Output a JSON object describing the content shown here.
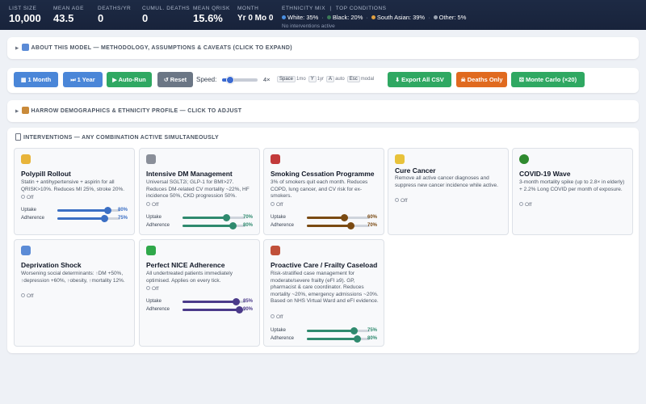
{
  "header": {
    "stats": [
      {
        "label": "LIST SIZE",
        "value": "10,000"
      },
      {
        "label": "MEAN AGE",
        "value": "43.5"
      },
      {
        "label": "DEATHS/YR",
        "value": "0"
      },
      {
        "label": "CUMUL. DEATHS",
        "value": "0"
      },
      {
        "label": "MEAN QRISK",
        "value": "15.6%"
      },
      {
        "label": "MONTH",
        "value": "Yr 0 Mo 0"
      }
    ],
    "ethnicity_label": "ETHNICITY MIX",
    "separator": "|",
    "conditions_label": "TOP CONDITIONS",
    "ethnicity": [
      {
        "name": "White: 35%",
        "color": "#4a90e2"
      },
      {
        "name": "Black: 20%",
        "color": "#3b7a57"
      },
      {
        "name": "South Asian: 39%",
        "color": "#e0a040"
      },
      {
        "name": "Other: 5%",
        "color": "#9aa3b2"
      }
    ],
    "no_interventions": "No interventions active"
  },
  "about": {
    "label": "ABOUT THIS MODEL — METHODOLOGY, ASSUMPTIONS & CAVEATS (CLICK TO EXPAND)"
  },
  "demographics": {
    "label": "HARROW DEMOGRAPHICS & ETHNICITY PROFILE — CLICK TO ADJUST"
  },
  "toolbar": {
    "month_btn": "1 Month",
    "year_btn": "1 Year",
    "autorun_btn": "Auto-Run",
    "reset_btn": "Reset",
    "speed_label": "Speed:",
    "speed_value": "4×",
    "speed_fraction": 0.22,
    "shortcuts": [
      {
        "key": "Space",
        "action": "1mo"
      },
      {
        "key": "Y",
        "action": "1yr"
      },
      {
        "key": "A",
        "action": "auto"
      },
      {
        "key": "Esc",
        "action": "modal"
      }
    ],
    "export_btn": "Export All CSV",
    "deaths_btn": "Deaths Only",
    "monte_btn": "Monte Carlo (×20)",
    "colors": {
      "blue": "#4a86d8",
      "grey": "#6b7685",
      "green": "#2fa862",
      "orange": "#e06a1f"
    }
  },
  "interventions": {
    "title": "INTERVENTIONS — ANY COMBINATION ACTIVE SIMULTANEOUSLY",
    "off_label": "Off",
    "uptake_label": "Uptake",
    "adherence_label": "Adherence",
    "cards": [
      {
        "title": "Polypill Rollout",
        "icon": "pill-icon",
        "icon_color": "#e8b43a",
        "desc": "Statin + antihypertensive + aspirin for all QRISK>10%. Reduces MI 25%, stroke 20%.",
        "sliders": [
          {
            "label": "Uptake",
            "value": "80%",
            "fraction": 0.8
          },
          {
            "label": "Adherence",
            "value": "75%",
            "fraction": 0.75
          }
        ],
        "accent": "#3b6fc4"
      },
      {
        "title": "Intensive DM Management",
        "icon": "stethoscope-icon",
        "icon_color": "#8a8f99",
        "desc": "Universal SGLT2i; GLP-1 for BMI>27. Reduces DM-related CV mortality ~22%, HF incidence 50%, CKD progression 50%.",
        "sliders": [
          {
            "label": "Uptake",
            "value": "70%",
            "fraction": 0.7
          },
          {
            "label": "Adherence",
            "value": "80%",
            "fraction": 0.8
          }
        ],
        "accent": "#2f8a6e"
      },
      {
        "title": "Smoking Cessation Programme",
        "icon": "no-smoking-icon",
        "icon_color": "#c23a3a",
        "desc": "3% of smokers quit each month. Reduces COPD, lung cancer, and CV risk for ex-smokers.",
        "sliders": [
          {
            "label": "Uptake",
            "value": "60%",
            "fraction": 0.6
          },
          {
            "label": "Adherence",
            "value": "70%",
            "fraction": 0.7
          }
        ],
        "accent": "#7a4a12"
      },
      {
        "title": "Cure Cancer",
        "icon": "ribbon-icon",
        "icon_color": "#e8c23a",
        "desc": "Remove all active cancer diagnoses and suppress new cancer incidence while active.",
        "sliders": [],
        "accent": "#3b6fc4"
      },
      {
        "title": "COVID-19 Wave",
        "icon": "virus-icon",
        "icon_color": "#2f8a2f",
        "desc": "3-month mortality spike (up to 2.8× in elderly) + 2.2% Long COVID per month of exposure.",
        "sliders": [],
        "accent": "#3b6fc4"
      },
      {
        "title": "Deprivation Shock",
        "icon": "chart-down-icon",
        "icon_color": "#5b8bd6",
        "desc": "Worsening social determinants: ↑DM +50%, ↑depression +60%, ↑obesity, ↑mortality 12%.",
        "sliders": [],
        "accent": "#3b6fc4"
      },
      {
        "title": "Perfect NICE Adherence",
        "icon": "check-icon",
        "icon_color": "#2fa84a",
        "desc": "All undertreated patients immediately optimised. Applies on every tick.",
        "sliders": [
          {
            "label": "Uptake",
            "value": "85%",
            "fraction": 0.85
          },
          {
            "label": "Adherence",
            "value": "90%",
            "fraction": 0.9
          }
        ],
        "accent": "#4b3a8a"
      },
      {
        "title": "Proactive Care / Frailty Caseload",
        "icon": "hospital-icon",
        "icon_color": "#c0503a",
        "desc": "Risk-stratified case management for moderate/severe frailty (eFI ≥9). GP, pharmacist & care coordinator. Reduces mortality ~20%, emergency admissions ~20%. Based on NHS Virtual Ward and eFI evidence.",
        "sliders": [
          {
            "label": "Uptake",
            "value": "75%",
            "fraction": 0.75
          },
          {
            "label": "Adherence",
            "value": "80%",
            "fraction": 0.8
          }
        ],
        "accent": "#2f8a6e"
      }
    ]
  }
}
